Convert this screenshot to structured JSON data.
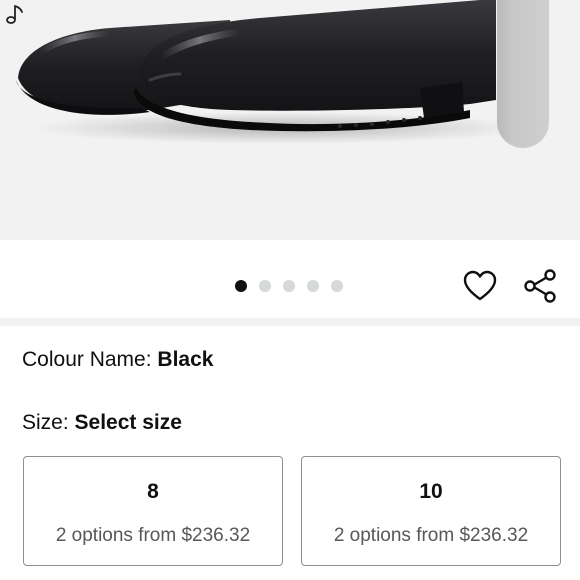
{
  "product": {
    "image_alt": "Black rubber boots",
    "carousel": {
      "count": 5,
      "active_index": 0
    }
  },
  "icons": {
    "music": "music-note-icon",
    "wishlist": "heart-icon",
    "share": "share-icon"
  },
  "colour": {
    "label": "Colour Name:",
    "value": "Black"
  },
  "size": {
    "label": "Size:",
    "value": "Select size",
    "options": [
      {
        "size": "8",
        "detail": "2 options from $236.32"
      },
      {
        "size": "10",
        "detail": "2 options from $236.32"
      }
    ]
  },
  "colors": {
    "active_dot": "#0f1111",
    "inactive_dot": "#d5d9d9",
    "card_border": "#8d9096",
    "secondary_text": "#565959"
  }
}
